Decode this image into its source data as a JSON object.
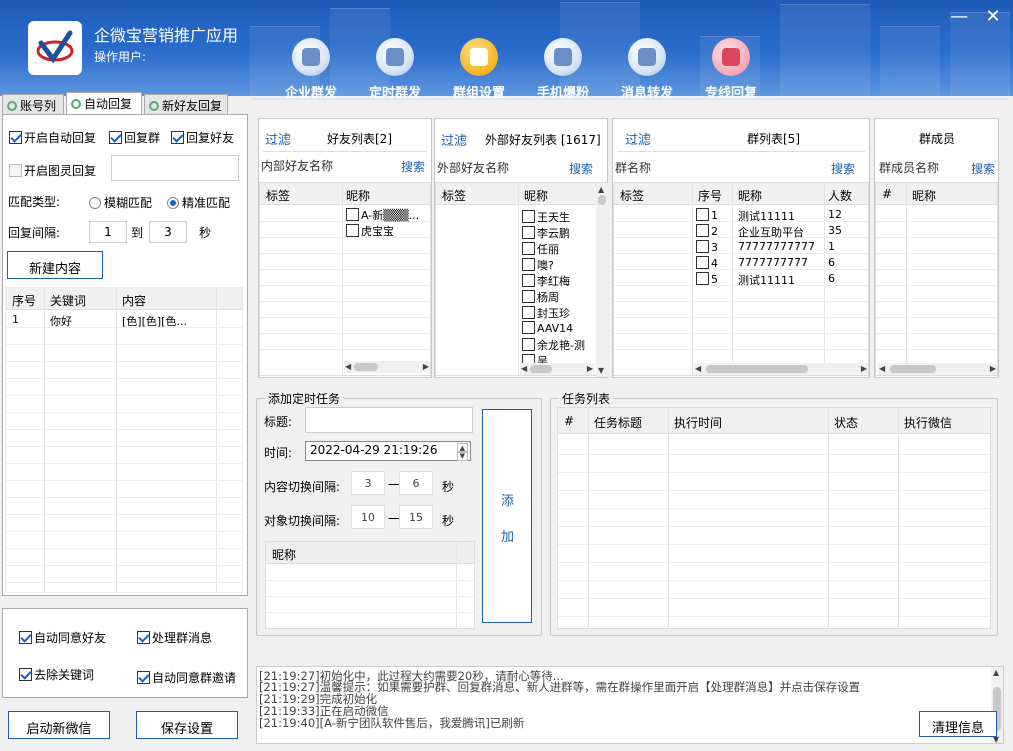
{
  "app": {
    "title": "企微宝营销推广应用",
    "user_label": "操作用户:"
  },
  "window": {
    "minimize": "—",
    "close": "✕"
  },
  "toolbar": [
    {
      "label": "企业群发",
      "icon": "share-network-icon"
    },
    {
      "label": "定时群发",
      "icon": "clock-calendar-icon"
    },
    {
      "label": "群组设置",
      "icon": "settings-circle-icon"
    },
    {
      "label": "手机爆粉",
      "icon": "people-group-icon"
    },
    {
      "label": "消息转发",
      "icon": "cycle-users-icon"
    },
    {
      "label": "专线回复",
      "icon": "team-icon"
    }
  ],
  "tabs": [
    "账号列",
    "自动回复",
    "新好友回复"
  ],
  "active_tab": "自动回复",
  "auto_reply": {
    "enable_auto_reply": {
      "label": "开启自动回复",
      "checked": true
    },
    "reply_group": {
      "label": "回复群",
      "checked": true
    },
    "reply_friend": {
      "label": "回复好友",
      "checked": true
    },
    "enable_image_reply": {
      "label": "开启图灵回复",
      "checked": false
    },
    "match_type_label": "匹配类型:",
    "fuzzy_match": {
      "label": "模糊匹配",
      "selected": false
    },
    "exact_match": {
      "label": "精准匹配",
      "selected": true
    },
    "interval_label": "回复间隔:",
    "interval_from": "1",
    "interval_to_label": "到",
    "interval_to": "3",
    "interval_unit": "秒",
    "new_content_button": "新建内容",
    "table": {
      "headers": [
        "序号",
        "关键词",
        "内容"
      ],
      "rows": [
        [
          "1",
          "你好",
          "[色][色][色..."
        ]
      ]
    }
  },
  "bottom_options": [
    {
      "label": "自动同意好友",
      "checked": true
    },
    {
      "label": "处理群消息",
      "checked": true
    },
    {
      "label": "去除关键词",
      "checked": true
    },
    {
      "label": "自动同意群邀请",
      "checked": true
    }
  ],
  "buttons": {
    "start_wechat": "启动新微信",
    "save_settings": "保存设置",
    "clear_info": "清理信息"
  },
  "friends_panel": {
    "filter": "过滤",
    "title": "好友列表[2]",
    "search_label": "内部好友名称",
    "search": "搜索",
    "headers": [
      "标签",
      "昵称"
    ],
    "rows": [
      "A-新▒▒▒...",
      "虎宝宝"
    ]
  },
  "external_panel": {
    "filter": "过滤",
    "title": "外部好友列表 [1617]",
    "search_label": "外部好友名称",
    "search": "搜索",
    "headers": [
      "标签",
      "昵称"
    ],
    "rows": [
      "王天生",
      "李云鹏",
      "任丽",
      "噢?",
      "李红梅",
      "杨周",
      "封玉珍",
      "AAV14",
      "余龙艳-测",
      "吴"
    ]
  },
  "group_panel": {
    "filter": "过滤",
    "title": "群列表[5]",
    "search_label": "群名称",
    "search": "搜索",
    "headers": [
      "标签",
      "序号",
      "昵称",
      "人数"
    ],
    "rows": [
      [
        "1",
        "测试11111",
        "12"
      ],
      [
        "2",
        "企业互助平台",
        "35"
      ],
      [
        "3",
        "77777777777",
        "1"
      ],
      [
        "4",
        "7777777777",
        "6"
      ],
      [
        "5",
        "测试11111",
        "6"
      ]
    ]
  },
  "member_panel": {
    "title": "群成员",
    "search_label": "群成员名称",
    "search": "搜索",
    "headers": [
      "#",
      "昵称"
    ]
  },
  "timed_task": {
    "group_title": "添加定时任务",
    "title_label": "标题:",
    "title_value": "",
    "time_label": "时间:",
    "time_value": "2022-04-29 21:19:26",
    "content_interval_label": "内容切换间隔:",
    "content_from": "3",
    "content_to": "6",
    "object_interval_label": "对象切换间隔:",
    "object_from": "10",
    "object_to": "15",
    "dash": "一",
    "unit": "秒",
    "nickname_header": "昵称",
    "add_button": [
      "添",
      "加"
    ]
  },
  "task_list": {
    "group_title": "任务列表",
    "headers": [
      "#",
      "任务标题",
      "执行时间",
      "状态",
      "执行微信"
    ]
  },
  "log": [
    "[21:19:27]初始化中，此过程大约需要20秒，请耐心等待...",
    "[21:19:27]温馨提示：如果需要护群、回复群消息、新人进群等，需在群操作里面开启【处理群消息】并点击保存设置",
    "[21:19:29]完成初始化",
    "[21:19:33]正在启动微信",
    "[21:19:40][A-新宁团队软件售后，我爱腾讯]已刷新"
  ]
}
